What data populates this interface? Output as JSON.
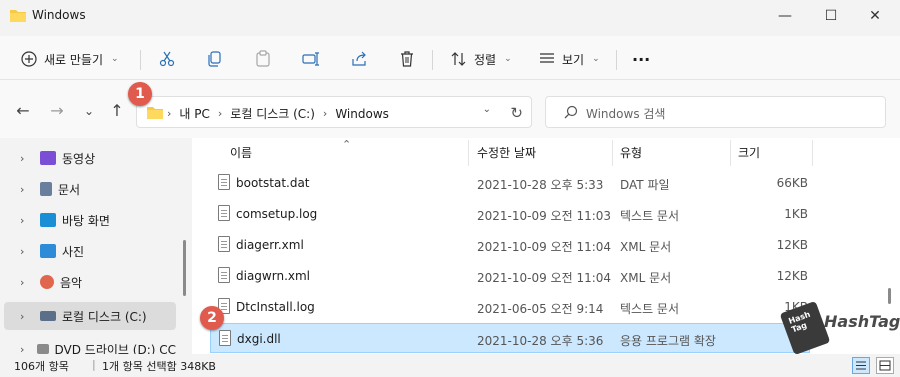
{
  "window": {
    "title": "Windows",
    "minimize_glyph": "—",
    "maximize_glyph": "☐",
    "close_glyph": "✕"
  },
  "toolbar": {
    "new_label": "새로 만들기",
    "sort_label": "정렬",
    "view_label": "보기",
    "more_glyph": "···",
    "icons": [
      "plus-circle-icon",
      "cut-icon",
      "copy-icon",
      "paste-icon",
      "rename-icon",
      "share-icon",
      "delete-icon",
      "sort-icon",
      "view-icon"
    ]
  },
  "nav": {
    "back_glyph": "←",
    "forward_glyph": "→",
    "recent_glyph": "⌄",
    "up_glyph": "↑"
  },
  "address": {
    "crumbs": [
      "내 PC",
      "로컬 디스크 (C:)",
      "Windows"
    ],
    "separator": "›"
  },
  "search": {
    "placeholder": "Windows 검색"
  },
  "sidebar": {
    "items": [
      {
        "label": "동영상",
        "icon": "videos-icon",
        "color": "#7a4fd6"
      },
      {
        "label": "문서",
        "icon": "documents-icon",
        "color": "#6a7f9e"
      },
      {
        "label": "바탕 화면",
        "icon": "desktop-icon",
        "color": "#1b8fd6"
      },
      {
        "label": "사진",
        "icon": "pictures-icon",
        "color": "#2e8bd8"
      },
      {
        "label": "음악",
        "icon": "music-icon",
        "color": "#e0674d"
      },
      {
        "label": "로컬 디스크 (C:)",
        "icon": "drive-icon",
        "color": "#5b6e8a"
      },
      {
        "label": "DVD 드라이브 (D:) CC",
        "icon": "dvd-icon",
        "color": "#8a8a8a"
      }
    ],
    "expand_glyph": "›"
  },
  "columns": {
    "name": "이름",
    "date": "수정한 날짜",
    "type": "유형",
    "size": "크기"
  },
  "files": [
    {
      "name": "bootstat.dat",
      "date": "2021-10-28 오후 5:33",
      "type": "DAT 파일",
      "size": "66KB"
    },
    {
      "name": "comsetup.log",
      "date": "2021-10-09 오전 11:03",
      "type": "텍스트 문서",
      "size": "1KB"
    },
    {
      "name": "diagerr.xml",
      "date": "2021-10-09 오전 11:04",
      "type": "XML 문서",
      "size": "12KB"
    },
    {
      "name": "diagwrn.xml",
      "date": "2021-10-09 오전 11:04",
      "type": "XML 문서",
      "size": "12KB"
    },
    {
      "name": "DtcInstall.log",
      "date": "2021-06-05 오전 9:14",
      "type": "텍스트 문서",
      "size": "1KB"
    },
    {
      "name": "dxgi.dll",
      "date": "2021-10-28 오후 5:36",
      "type": "응용 프로그램 확장",
      "size": "3"
    }
  ],
  "status": {
    "count": "106개 항목",
    "selection": "1개 항목 선택함 348KB"
  },
  "badges": [
    "1",
    "2"
  ],
  "watermark": {
    "logo_text": "Hash Tag",
    "text": "HashTag"
  },
  "colors": {
    "selection": "#cce8ff",
    "selection_border": "#99d1ff",
    "badge": "#e05a4d",
    "folder": "#f7c948"
  }
}
